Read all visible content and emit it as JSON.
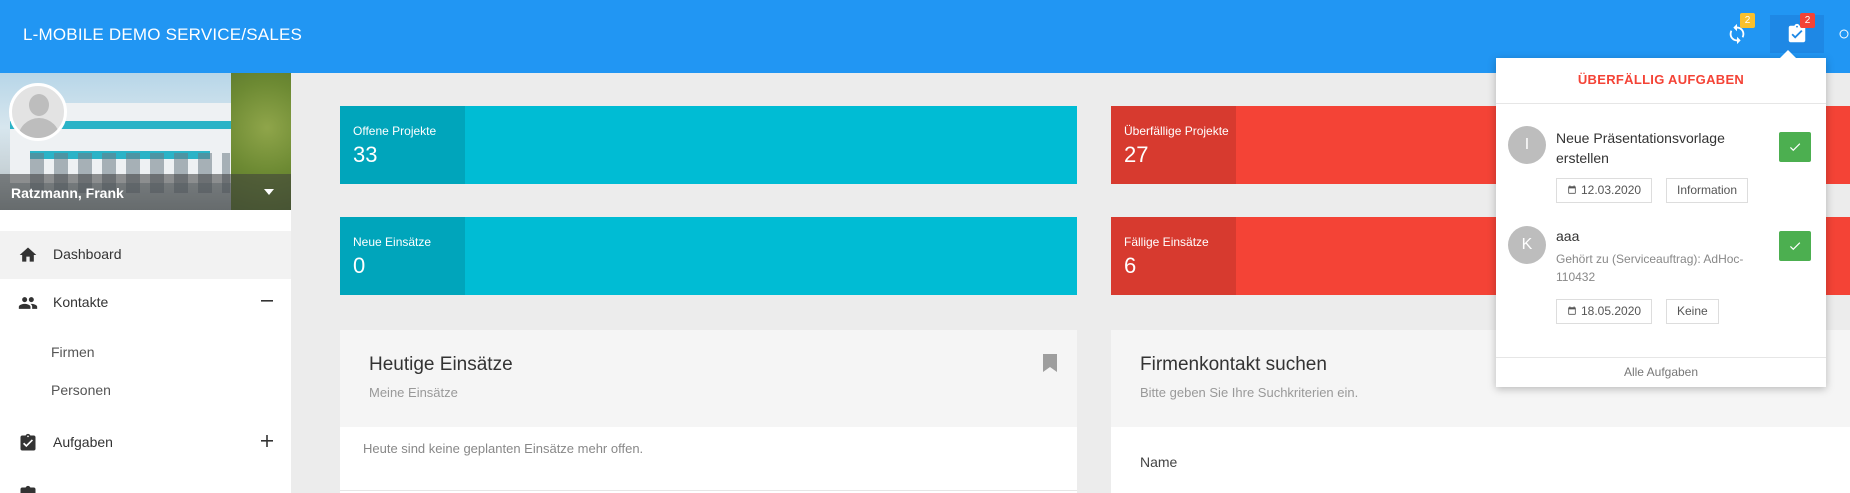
{
  "app": {
    "title": "L-MOBILE DEMO SERVICE/SALES"
  },
  "topbar": {
    "sync_badge": "2",
    "tasks_badge": "2"
  },
  "colors": {
    "primary": "#2196f3",
    "cyan": "#00bcd4",
    "red": "#f44336",
    "success": "#4caf50"
  },
  "profile": {
    "name": "Ratzmann, Frank"
  },
  "sidebar": {
    "items": [
      {
        "label": "Dashboard",
        "icon": "home-icon"
      },
      {
        "label": "Kontakte",
        "icon": "contacts-icon"
      },
      {
        "label": "Firmen"
      },
      {
        "label": "Personen"
      },
      {
        "label": "Aufgaben",
        "icon": "clipboard-check-icon"
      }
    ]
  },
  "tiles": {
    "open_projects": {
      "label": "Offene Projekte",
      "value": "33"
    },
    "overdue_projects": {
      "label": "Überfällige Projekte",
      "value": "27"
    },
    "new_dispatches": {
      "label": "Neue Einsätze",
      "value": "0"
    },
    "due_dispatches": {
      "label": "Fällige Einsätze",
      "value": "6"
    }
  },
  "cards": {
    "today": {
      "title": "Heutige Einsätze",
      "subtitle": "Meine Einsätze",
      "body": "Heute sind keine geplanten Einsätze mehr offen."
    },
    "company_search": {
      "title": "Firmenkontakt suchen",
      "subtitle": "Bitte geben Sie Ihre Suchkriterien ein.",
      "field_label": "Name"
    }
  },
  "overdue_dropdown": {
    "title": "ÜBERFÄLLIG AUFGABEN",
    "tasks": [
      {
        "initial": "I",
        "title": "Neue Präsentationsvorlage erstellen",
        "description": "",
        "date": "12.03.2020",
        "category": "Information"
      },
      {
        "initial": "K",
        "title": "aaa",
        "description": "Gehört zu (Serviceauftrag): AdHoc-110432",
        "date": "18.05.2020",
        "category": "Keine"
      }
    ],
    "footer": "Alle Aufgaben"
  }
}
